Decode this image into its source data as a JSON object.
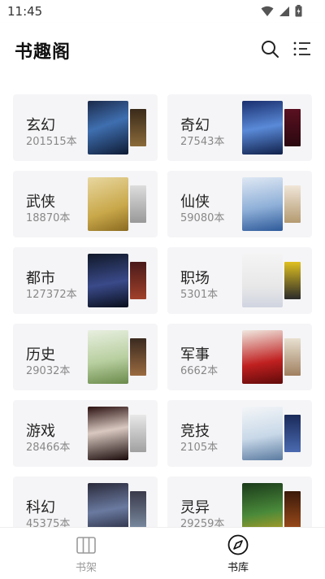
{
  "status": {
    "time": "11:45"
  },
  "header": {
    "title": "书趣阁"
  },
  "categories": [
    {
      "name": "玄幻",
      "count": "201515本"
    },
    {
      "name": "奇幻",
      "count": "27543本"
    },
    {
      "name": "武侠",
      "count": "18870本"
    },
    {
      "name": "仙侠",
      "count": "59080本"
    },
    {
      "name": "都市",
      "count": "127372本"
    },
    {
      "name": "职场",
      "count": "5301本"
    },
    {
      "name": "历史",
      "count": "29032本"
    },
    {
      "name": "军事",
      "count": "6662本"
    },
    {
      "name": "游戏",
      "count": "28466本"
    },
    {
      "name": "竞技",
      "count": "2105本"
    },
    {
      "name": "科幻",
      "count": "45375本"
    },
    {
      "name": "灵异",
      "count": "29259本"
    }
  ],
  "tabs": {
    "bookshelf": "书架",
    "library": "书库"
  },
  "colors": {
    "active_tab": "#111111",
    "inactive_tab": "#9a9a9a"
  }
}
